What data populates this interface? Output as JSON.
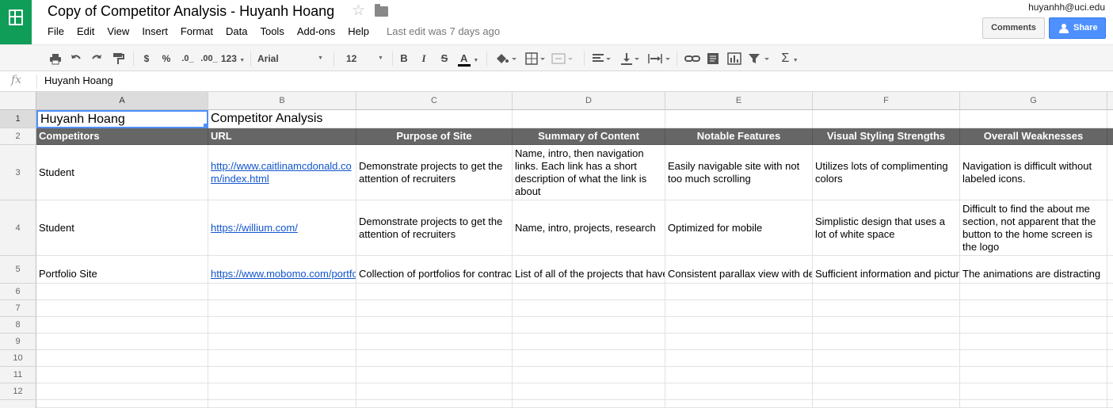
{
  "app": {
    "title": "Copy of Competitor Analysis - Huyanh Hoang",
    "last_edit": "Last edit was 7 days ago",
    "user_email": "huyanhh@uci.edu",
    "comments_label": "Comments",
    "share_label": "Share",
    "accent_color": "#0f9d58",
    "share_color": "#4d90fe"
  },
  "menu": [
    "File",
    "Edit",
    "View",
    "Insert",
    "Format",
    "Data",
    "Tools",
    "Add-ons",
    "Help"
  ],
  "toolbar": {
    "currency": "$",
    "percent": "%",
    "decrease_decimals": ".0_",
    "increase_decimals": ".00_",
    "number_format": "123",
    "font": "Arial",
    "font_size": "12",
    "bold": "B",
    "italic": "I",
    "strikethrough": "S",
    "text_color": "A",
    "functions": "Σ"
  },
  "formula_bar": {
    "fx_label": "fx",
    "value": "Huyanh Hoang"
  },
  "grid": {
    "columns": [
      "A",
      "B",
      "C",
      "D",
      "E",
      "F",
      "G"
    ],
    "rows": [
      "1",
      "2",
      "3",
      "4",
      "5",
      "6",
      "7",
      "8",
      "9",
      "10",
      "11",
      "12"
    ],
    "a1": "Huyanh Hoang",
    "b1": "Competitor Analysis",
    "headers": [
      "Competitors",
      "URL",
      "Purpose of Site",
      "Summary of Content",
      "Notable Features",
      "Visual Styling Strengths",
      "Overall Weaknesses"
    ],
    "row3": [
      "Student",
      "http://www.caitlinamcdonald.com/index.html",
      "Demonstrate projects to get the attention of recruiters",
      "Name, intro, then navigation links. Each link has a short description of what the link is about",
      "Easily navigable site with not too much scrolling",
      "Utilizes lots of complimenting colors",
      "Navigation is difficult without labeled icons."
    ],
    "row4": [
      "Student",
      "https://willium.com/",
      "Demonstrate projects to get the attention of recruiters",
      "Name, intro, projects, research",
      "Optimized for mobile",
      "Simplistic design that uses a lot of white space",
      "Difficult to find the about me section, not apparent that the button to the home screen is the logo"
    ],
    "row5": [
      "Portfolio Site",
      "https://www.mobomo.com/portfolio",
      "Collection of portfolios for contractors",
      "List of all of the projects that have been done",
      "Consistent parallax view with design",
      "Sufficient information and pictures",
      "The animations are distracting"
    ],
    "header_bg": "#666666",
    "link_color": "#1155cc"
  }
}
